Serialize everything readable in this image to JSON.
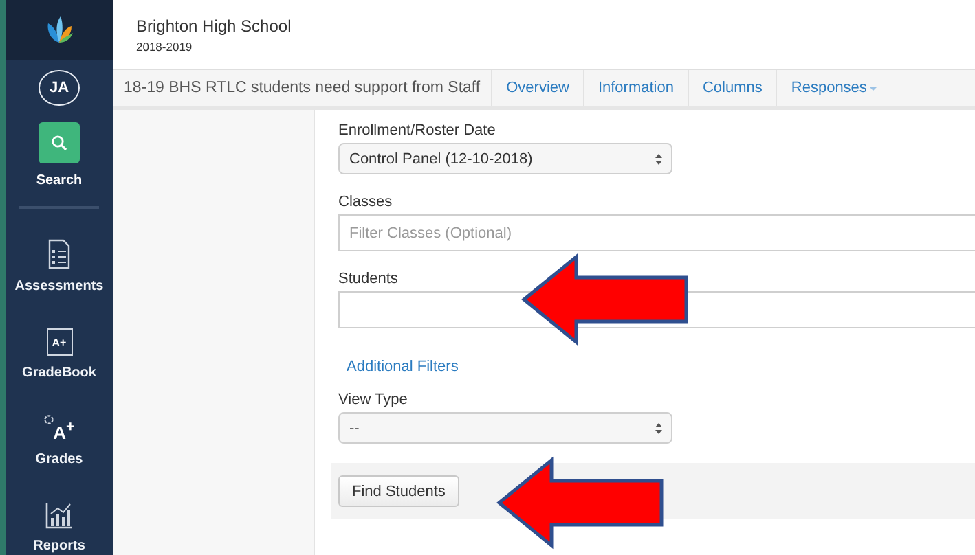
{
  "header": {
    "school": "Brighton High School",
    "year": "2018-2019"
  },
  "sidebar": {
    "avatar": "JA",
    "items": [
      {
        "kind": "search",
        "label": "Search",
        "selected": true
      },
      {
        "kind": "document",
        "label": "Assessments",
        "selected": false
      },
      {
        "kind": "gradebook",
        "label": "GradeBook",
        "selected": false,
        "icon_text": "A+"
      },
      {
        "kind": "grades",
        "label": "Grades",
        "selected": false,
        "icon_text": "A$^{+}$"
      },
      {
        "kind": "reports",
        "label": "Reports",
        "selected": false
      }
    ]
  },
  "toolbar": {
    "title": "18-19 BHS RTLC students need support from Staff",
    "tabs": [
      {
        "label": "Overview",
        "selected": false,
        "dropdown": false
      },
      {
        "label": "Information",
        "selected": false,
        "dropdown": false
      },
      {
        "label": "Columns",
        "selected": false,
        "dropdown": false
      },
      {
        "label": "Responses",
        "selected": false,
        "dropdown": true
      }
    ]
  },
  "form": {
    "fields": [
      {
        "kind": "select",
        "label": "Enrollment/Roster Date",
        "value": "Control Panel (12-10-2018)"
      },
      {
        "kind": "text",
        "label": "Classes",
        "placeholder": "Filter Classes (Optional)"
      },
      {
        "kind": "text",
        "label": "Students",
        "arrow": true
      },
      {
        "kind": "link",
        "label": "Additional Filters"
      },
      {
        "kind": "select",
        "label": "View Type",
        "value": "--"
      }
    ],
    "submit": {
      "label": "Find Students",
      "arrow": true
    }
  }
}
